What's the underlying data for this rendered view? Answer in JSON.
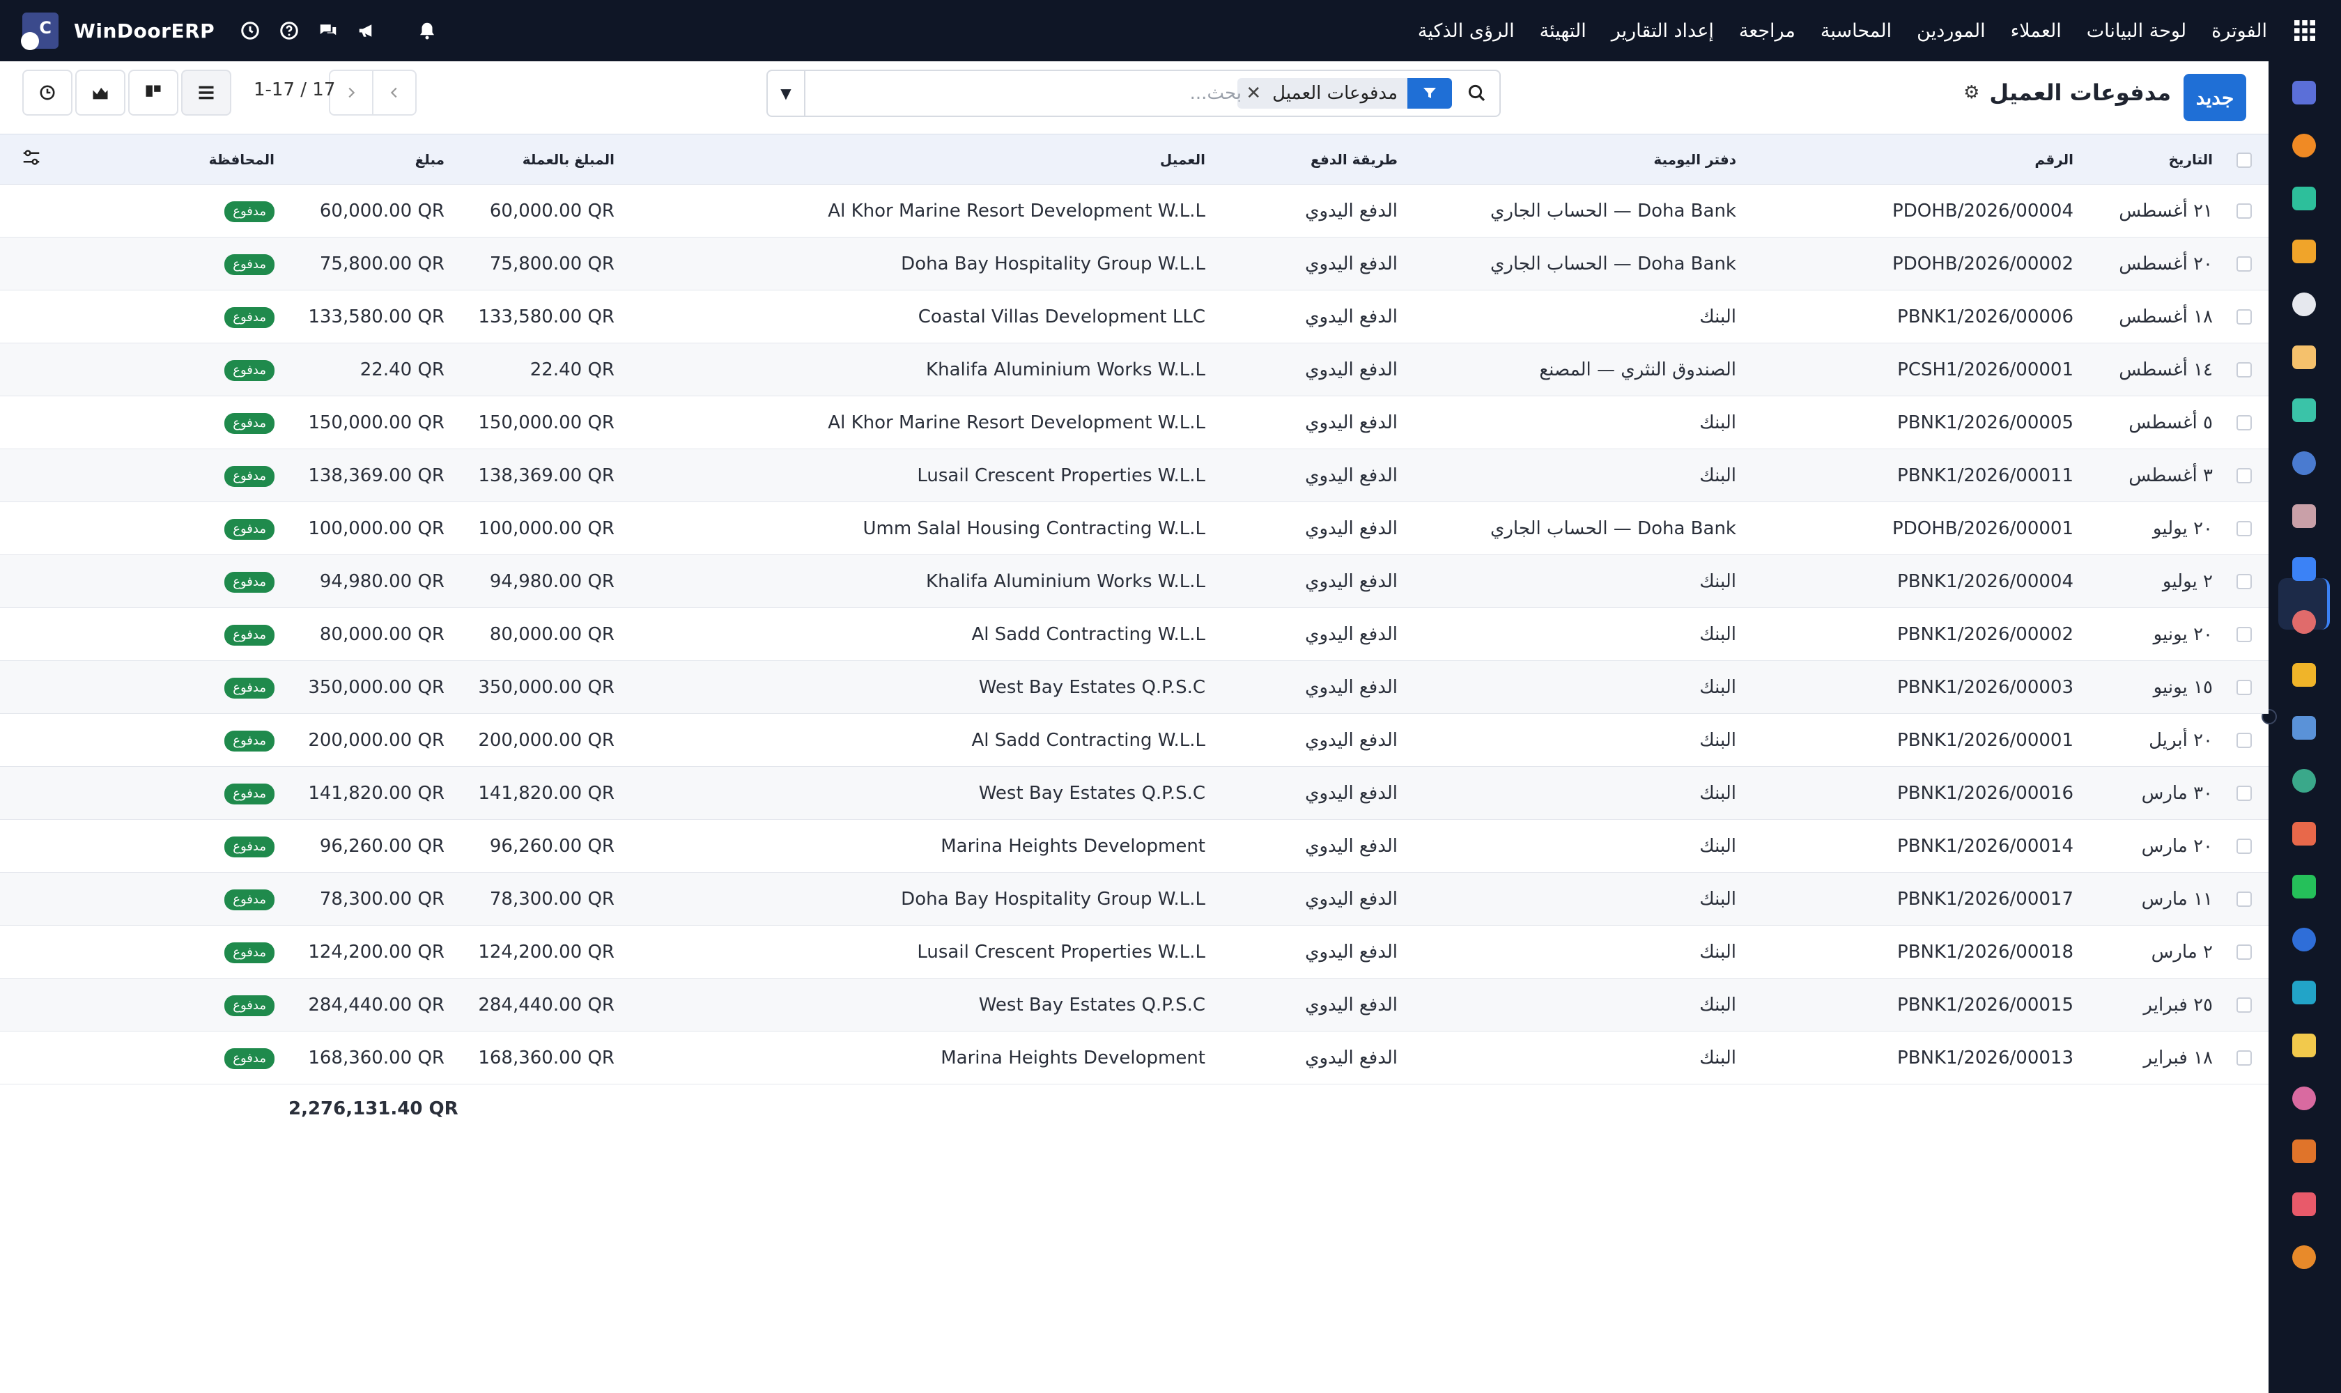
{
  "app": {
    "name": "WinDoorERP",
    "logo_letter": "C"
  },
  "topbar": {
    "menu": [
      "الفوترة",
      "لوحة البيانات",
      "العملاء",
      "الموردين",
      "المحاسبة",
      "مراجعة",
      "إعداد التقارير",
      "التهيئة",
      "الرؤى الذكية"
    ]
  },
  "control": {
    "new_button": "جديد",
    "title": "مدفوعات العميل",
    "search_facet": "مدفوعات العميل",
    "search_placeholder": "بحث...",
    "pager_text": "1-17 / 17"
  },
  "table": {
    "headers": {
      "date": "التاريخ",
      "number": "الرقم",
      "journal": "دفتر اليومية",
      "method": "طريقة الدفع",
      "customer": "العميل",
      "amount_currency": "المبلغ بالعملة",
      "amount": "مبلغ",
      "status": "المحافظة"
    },
    "rows": [
      {
        "date": "٢١ أغسطس",
        "number": "PDOHB/2026/00004",
        "journal": "Doha Bank — الحساب الجاري",
        "method": "الدفع اليدوي",
        "customer": "Al Khor Marine Resort Development W.L.L",
        "amount_currency": "60,000.00 QR",
        "amount": "60,000.00 QR",
        "status": "مدفوع"
      },
      {
        "date": "٢٠ أغسطس",
        "number": "PDOHB/2026/00002",
        "journal": "Doha Bank — الحساب الجاري",
        "method": "الدفع اليدوي",
        "customer": "Doha Bay Hospitality Group W.L.L",
        "amount_currency": "75,800.00 QR",
        "amount": "75,800.00 QR",
        "status": "مدفوع"
      },
      {
        "date": "١٨ أغسطس",
        "number": "PBNK1/2026/00006",
        "journal": "البنك",
        "method": "الدفع اليدوي",
        "customer": "Coastal Villas Development LLC",
        "amount_currency": "133,580.00 QR",
        "amount": "133,580.00 QR",
        "status": "مدفوع"
      },
      {
        "date": "١٤ أغسطس",
        "number": "PCSH1/2026/00001",
        "journal": "الصندوق النثري — المصنع",
        "method": "الدفع اليدوي",
        "customer": "Khalifa Aluminium Works W.L.L",
        "amount_currency": "22.40 QR",
        "amount": "22.40 QR",
        "status": "مدفوع"
      },
      {
        "date": "٥ أغسطس",
        "number": "PBNK1/2026/00005",
        "journal": "البنك",
        "method": "الدفع اليدوي",
        "customer": "Al Khor Marine Resort Development W.L.L",
        "amount_currency": "150,000.00 QR",
        "amount": "150,000.00 QR",
        "status": "مدفوع"
      },
      {
        "date": "٣ أغسطس",
        "number": "PBNK1/2026/00011",
        "journal": "البنك",
        "method": "الدفع اليدوي",
        "customer": "Lusail Crescent Properties W.L.L",
        "amount_currency": "138,369.00 QR",
        "amount": "138,369.00 QR",
        "status": "مدفوع"
      },
      {
        "date": "٢٠ يوليو",
        "number": "PDOHB/2026/00001",
        "journal": "Doha Bank — الحساب الجاري",
        "method": "الدفع اليدوي",
        "customer": "Umm Salal Housing Contracting W.L.L",
        "amount_currency": "100,000.00 QR",
        "amount": "100,000.00 QR",
        "status": "مدفوع"
      },
      {
        "date": "٢ يوليو",
        "number": "PBNK1/2026/00004",
        "journal": "البنك",
        "method": "الدفع اليدوي",
        "customer": "Khalifa Aluminium Works W.L.L",
        "amount_currency": "94,980.00 QR",
        "amount": "94,980.00 QR",
        "status": "مدفوع"
      },
      {
        "date": "٢٠ يونيو",
        "number": "PBNK1/2026/00002",
        "journal": "البنك",
        "method": "الدفع اليدوي",
        "customer": "Al Sadd Contracting W.L.L",
        "amount_currency": "80,000.00 QR",
        "amount": "80,000.00 QR",
        "status": "مدفوع"
      },
      {
        "date": "١٥ يونيو",
        "number": "PBNK1/2026/00003",
        "journal": "البنك",
        "method": "الدفع اليدوي",
        "customer": "West Bay Estates Q.P.S.C",
        "amount_currency": "350,000.00 QR",
        "amount": "350,000.00 QR",
        "status": "مدفوع"
      },
      {
        "date": "٢٠ أبريل",
        "number": "PBNK1/2026/00001",
        "journal": "البنك",
        "method": "الدفع اليدوي",
        "customer": "Al Sadd Contracting W.L.L",
        "amount_currency": "200,000.00 QR",
        "amount": "200,000.00 QR",
        "status": "مدفوع"
      },
      {
        "date": "٣٠ مارس",
        "number": "PBNK1/2026/00016",
        "journal": "البنك",
        "method": "الدفع اليدوي",
        "customer": "West Bay Estates Q.P.S.C",
        "amount_currency": "141,820.00 QR",
        "amount": "141,820.00 QR",
        "status": "مدفوع"
      },
      {
        "date": "٢٠ مارس",
        "number": "PBNK1/2026/00014",
        "journal": "البنك",
        "method": "الدفع اليدوي",
        "customer": "Marina Heights Development",
        "amount_currency": "96,260.00 QR",
        "amount": "96,260.00 QR",
        "status": "مدفوع"
      },
      {
        "date": "١١ مارس",
        "number": "PBNK1/2026/00017",
        "journal": "البنك",
        "method": "الدفع اليدوي",
        "customer": "Doha Bay Hospitality Group W.L.L",
        "amount_currency": "78,300.00 QR",
        "amount": "78,300.00 QR",
        "status": "مدفوع"
      },
      {
        "date": "٢ مارس",
        "number": "PBNK1/2026/00018",
        "journal": "البنك",
        "method": "الدفع اليدوي",
        "customer": "Lusail Crescent Properties W.L.L",
        "amount_currency": "124,200.00 QR",
        "amount": "124,200.00 QR",
        "status": "مدفوع"
      },
      {
        "date": "٢٥ فبراير",
        "number": "PBNK1/2026/00015",
        "journal": "البنك",
        "method": "الدفع اليدوي",
        "customer": "West Bay Estates Q.P.S.C",
        "amount_currency": "284,440.00 QR",
        "amount": "284,440.00 QR",
        "status": "مدفوع"
      },
      {
        "date": "١٨ فبراير",
        "number": "PBNK1/2026/00013",
        "journal": "البنك",
        "method": "الدفع اليدوي",
        "customer": "Marina Heights Development",
        "amount_currency": "168,360.00 QR",
        "amount": "168,360.00 QR",
        "status": "مدفوع"
      }
    ],
    "total": "2,276,131.40 QR"
  },
  "colors": {
    "topbar": "#0f1626",
    "accent": "#1f6fd6",
    "paid_badge": "#1f8a4c",
    "header_row": "#eef2fa"
  },
  "rail_icons": [
    "mail-icon",
    "chat-bubble-icon",
    "ticket-icon",
    "bar-chart-icon",
    "cube-icon",
    "photo-icon",
    "check-icon",
    "book-icon",
    "package-icon",
    "payments-icon",
    "users-icon",
    "calendar-icon",
    "pen-icon",
    "contact-icon",
    "dashboard-icon",
    "whatsapp-icon",
    "compass-icon",
    "wave-icon",
    "send-icon",
    "card-icon",
    "hexagon-icon",
    "pie-icon",
    "cog-hex-icon"
  ]
}
